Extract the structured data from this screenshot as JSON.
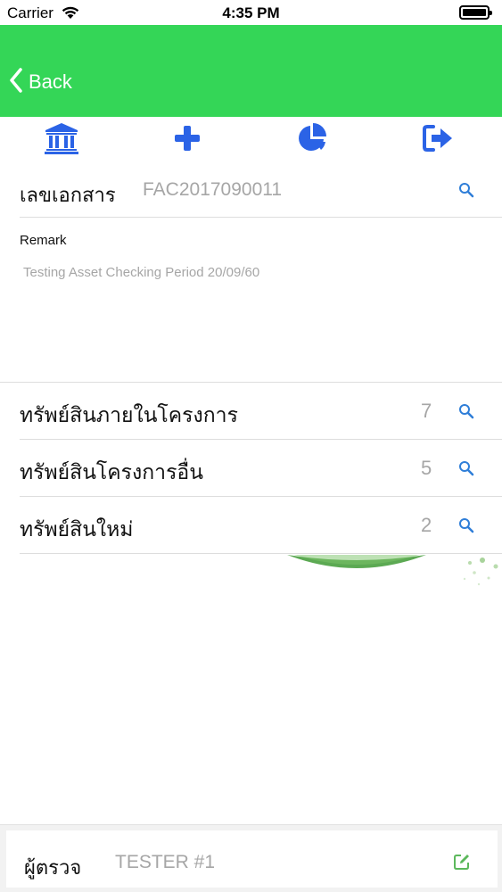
{
  "status_bar": {
    "carrier": "Carrier",
    "time": "4:35 PM"
  },
  "nav": {
    "back_label": "Back"
  },
  "toolbar": {
    "icons": [
      "bank-icon",
      "plus-icon",
      "pie-chart-icon",
      "sign-out-icon"
    ]
  },
  "document": {
    "label": "เลขเอกสาร",
    "value": "FAC2017090011"
  },
  "remark": {
    "label": "Remark",
    "text": "Testing Asset Checking Period 20/09/60"
  },
  "assets": [
    {
      "label": "ทรัพย์สินภายในโครงการ",
      "count": "7"
    },
    {
      "label": "ทรัพย์สินโครงการอื่น",
      "count": "5"
    },
    {
      "label": "ทรัพย์สินใหม่",
      "count": "2"
    }
  ],
  "inspector": {
    "label": "ผู้ตรวจ",
    "value": "TESTER #1"
  },
  "colors": {
    "nav_green": "#34d657",
    "icon_blue": "#2b63e6",
    "search_blue": "#2f7ed8",
    "edit_green": "#5cb85c",
    "placeholder_gray": "#a6a6a6"
  }
}
